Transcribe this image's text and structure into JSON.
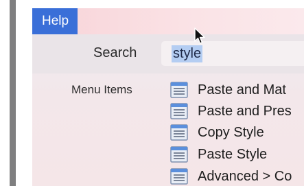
{
  "menubar": {
    "help_label": "Help"
  },
  "search": {
    "label": "Search",
    "value": "style"
  },
  "results": {
    "section_label": "Menu Items",
    "items": [
      {
        "label": "Paste and Mat",
        "icon": "menu-item-icon"
      },
      {
        "label": "Paste and Pres",
        "icon": "menu-item-icon"
      },
      {
        "label": "Copy Style",
        "icon": "menu-item-icon"
      },
      {
        "label": "Paste Style",
        "icon": "menu-item-icon"
      },
      {
        "label": "Advanced > Co",
        "icon": "menu-item-icon"
      }
    ]
  },
  "colors": {
    "menu_highlight": "#3a6fd8",
    "text_selection": "#b4cdf2",
    "side_bar": "#7f7f80"
  }
}
